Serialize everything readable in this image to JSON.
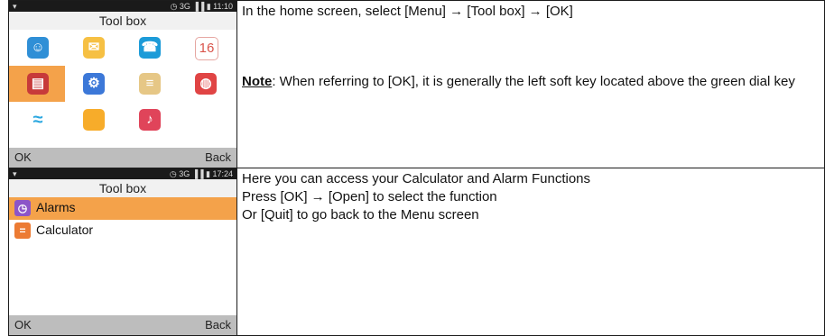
{
  "rows": [
    {
      "phone": {
        "status_left": "▾",
        "status_right": "◷ 3G ▐▐ ▮ 11:10",
        "title": "Tool box",
        "softkey_left": "OK",
        "softkey_right": "Back",
        "icons": [
          {
            "name": "contacts-icon",
            "glyph": "☺",
            "color": "#2f8fd6"
          },
          {
            "name": "messages-icon",
            "glyph": "✉",
            "color": "#f6c043"
          },
          {
            "name": "phone-icon",
            "glyph": "☎",
            "color": "#1c9bd8"
          },
          {
            "name": "calendar-icon",
            "glyph": "16",
            "color": "#ffffff"
          },
          {
            "name": "toolbox-icon",
            "glyph": "▤",
            "color": "#c73a3a"
          },
          {
            "name": "settings-icon",
            "glyph": "⚙",
            "color": "#3c78d8"
          },
          {
            "name": "file-manager-icon",
            "glyph": "≡",
            "color": "#e6c786"
          },
          {
            "name": "browser-icon",
            "glyph": "◍",
            "color": "#e04444"
          },
          {
            "name": "wifi-icon",
            "glyph": "≈",
            "color": "#2aa7e0"
          },
          {
            "name": "notes-icon",
            "glyph": "",
            "color": "#f7ac2a"
          },
          {
            "name": "music-icon",
            "glyph": "♪",
            "color": "#e0445a"
          }
        ]
      },
      "text": {
        "line1": "In the home screen, select [Menu] → [Tool box] → [OK]",
        "note_label": "Note",
        "note_text": ": When referring to [OK], it is generally the left soft key located above the green dial key"
      }
    },
    {
      "phone": {
        "status_left": "▾",
        "status_right": "◷ 3G ▐▐ ▮ 17:24",
        "title": "Tool box",
        "softkey_left": "OK",
        "softkey_right": "Back",
        "items": [
          {
            "label": "Alarms",
            "glyph": "◷",
            "color": "#8c55c8"
          },
          {
            "label": "Calculator",
            "glyph": "=",
            "color": "#ec7b33"
          }
        ]
      },
      "text": {
        "line1": "Here you can access your Calculator and Alarm Functions",
        "line2": "Press [OK] → [Open] to select the function",
        "line3": "Or [Quit] to go back to the Menu screen"
      }
    }
  ],
  "colors": {
    "selection": "#f4a24a",
    "softkey_bar": "#bdbdbd",
    "status_bar": "#1a1a1a"
  }
}
